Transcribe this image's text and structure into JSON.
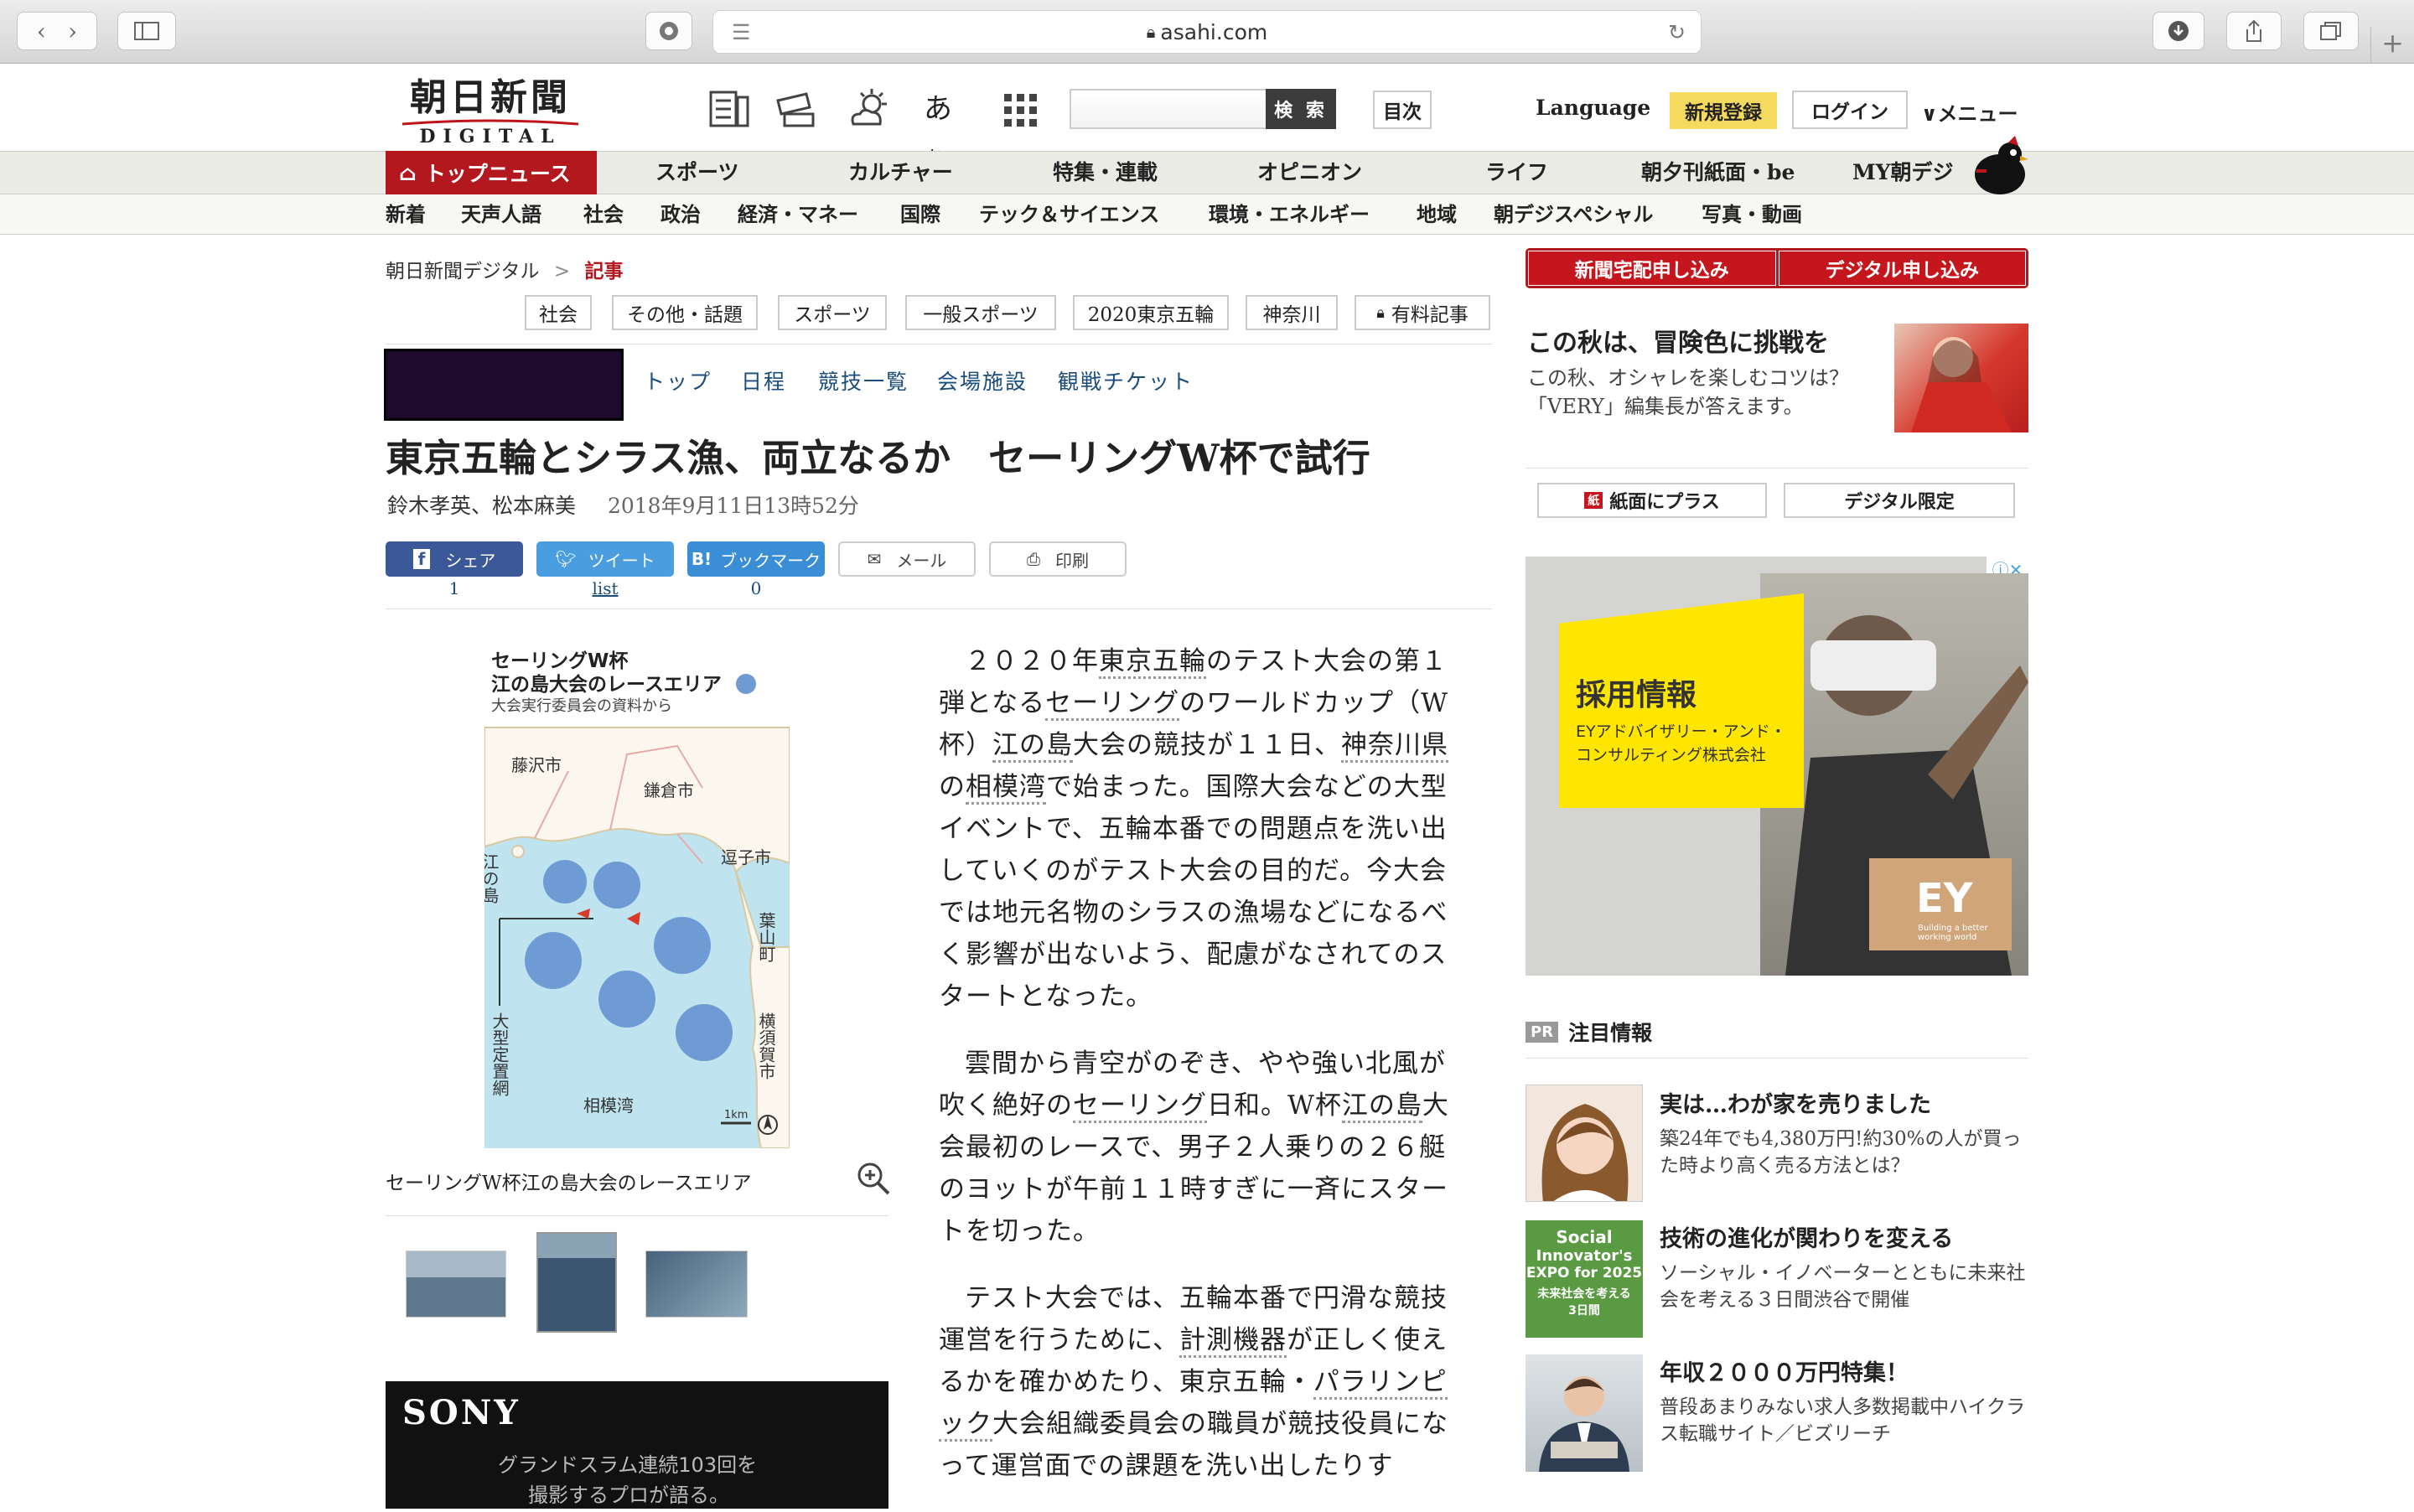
{
  "browser": {
    "url": "asahi.com"
  },
  "header": {
    "logo_main": "朝日新聞",
    "logo_sub": "DIGITAL",
    "search_button": "検 索",
    "index_button": "目次",
    "language": "Language",
    "register": "新規登録",
    "login": "ログイン",
    "menu": "メニュー"
  },
  "nav_primary": [
    "トップニュース",
    "スポーツ",
    "カルチャー",
    "特集・連載",
    "オピニオン",
    "ライフ",
    "朝夕刊紙面・be",
    "MY朝デジ"
  ],
  "nav_secondary": [
    "新着",
    "天声人語",
    "社会",
    "政治",
    "経済・マネー",
    "国際",
    "テック＆サイエンス",
    "環境・エネルギー",
    "地域",
    "朝デジスペシャル",
    "写真・動画"
  ],
  "breadcrumb": {
    "home": "朝日新聞デジタル",
    "sep": ">",
    "current": "記事"
  },
  "tags": [
    "社会",
    "その他・話題",
    "スポーツ",
    "一般スポーツ",
    "2020東京五輪",
    "神奈川",
    "有料記事"
  ],
  "section_nav": [
    "トップ",
    "日程",
    "競技一覧",
    "会場施設",
    "観戦チケット"
  ],
  "article": {
    "title": "東京五輪とシラス漁、両立なるか　セーリングW杯で試行",
    "authors": "鈴木孝英、松本麻美",
    "date": "2018年9月11日13時52分",
    "share": {
      "facebook": "シェア",
      "facebook_count": "1",
      "twitter": "ツイート",
      "twitter_count": "list",
      "bookmark": "ブックマーク",
      "bookmark_count": "0",
      "mail": "メール",
      "print": "印刷"
    },
    "caption": "セーリングW杯江の島大会のレースエリア",
    "map": {
      "title1": "セーリングW杯",
      "title2": "江の島大会のレースエリア",
      "source": "大会実行委員会の資料から",
      "fujisawa": "藤沢市",
      "kamakura": "鎌倉市",
      "enoshima": "江の島",
      "zushi": "逗子市",
      "hayama": "葉山町",
      "yokosuka": "横須賀市",
      "net": "大型定置網",
      "bay": "相模湾",
      "scale": "1km"
    },
    "p1": [
      "２０２０年",
      "東京五輪",
      "のテスト大会の第１弾となる",
      "セーリング",
      "のワールドカップ（W杯）",
      "江の島",
      "大会の競技が１１日、",
      "神奈川県",
      "の",
      "相模湾",
      "で始まった。国際大会などの大型イベントで、五輪本番での問題点を洗い出していくのがテスト大会の目的だ。今大会では地元名物のシラスの漁場などになるべく影響が出ないよう、配慮がなされてのスタートとなった。"
    ],
    "p2": [
      "雲間から青空がのぞき、やや強い北風が吹く絶好の",
      "セーリング",
      "日和。W杯",
      "江の島",
      "大会最初のレースで、男子２人乗りの２６艇のヨットが午前１１時すぎに一斉にスタートを切った。"
    ],
    "p3": [
      "テスト大会では、五輪本番で円滑な競技運営を行うために、",
      "計測機器",
      "が正しく使えるかを確かめたり、東京五輪・",
      "パラリンピック",
      "大会組織委員会の職員が競技役員になって運営面での課題を洗い出したりす"
    ]
  },
  "ad_left": {
    "brand": "SONY",
    "line1": "グランドスラム連続103回を",
    "line2": "撮影するプロが語る。"
  },
  "sidebar": {
    "btn_paper": "新聞宅配申し込み",
    "btn_digital": "デジタル申し込み",
    "promo_title": "この秋は、冒険色に挑戦を",
    "promo_desc": "この秋、オシャレを楽しむコツは？　「VERY」編集長が答えます。",
    "btn_plus": "紙面にプラス",
    "btn_limited": "デジタル限定",
    "ad": {
      "title": "採用情報",
      "sub1": "EYアドバイザリー・アンド・",
      "sub2": "コンサルティング株式会社",
      "logo": "EY",
      "tagline": "Building a better working world"
    },
    "pr_label": "PR",
    "pr_heading": "注目情報",
    "pr_items": [
      {
        "title": "実は…わが家を売りました",
        "desc": "築24年でも4,380万円!約30%の人が買った時より高く売る方法とは？"
      },
      {
        "title": "技術の進化が関わりを変える",
        "desc": "ソーシャル・イノベーターとともに未来社会を考える３日間渋谷で開催",
        "thumb1": "Social",
        "thumb2": "Innovator's",
        "thumb3": "EXPO for 2025",
        "thumb4": "未来社会を考える",
        "thumb5": "3日間"
      },
      {
        "title": "年収２０００万円特集！",
        "desc": "普段あまりみない求人多数掲載中ハイクラス転職サイト／ビズリーチ"
      }
    ]
  }
}
